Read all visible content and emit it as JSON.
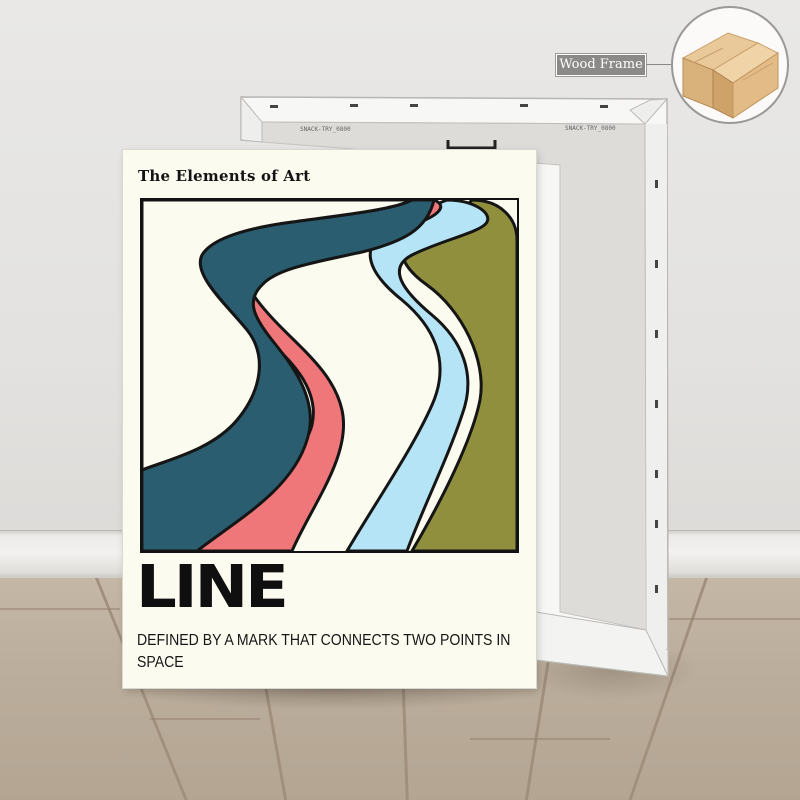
{
  "callout": {
    "label": "Wood Frame",
    "image_icon": "wood-frame-corner"
  },
  "poster": {
    "heading": "The Elements of Art",
    "title": "LINE",
    "description": "DEFINED BY A MARK THAT CONNECTS TWO POINTS IN SPACE",
    "stripe_colors": {
      "teal": "#2a5d70",
      "pink": "#ef7779",
      "light_blue": "#b4e4f6",
      "olive": "#8f8f3d"
    },
    "background": "#fbfbef"
  },
  "canvas_back": {
    "stamp_text_left": "SNACK-TRY_0800",
    "stamp_text_right": "SNACK-TRY_0800"
  }
}
